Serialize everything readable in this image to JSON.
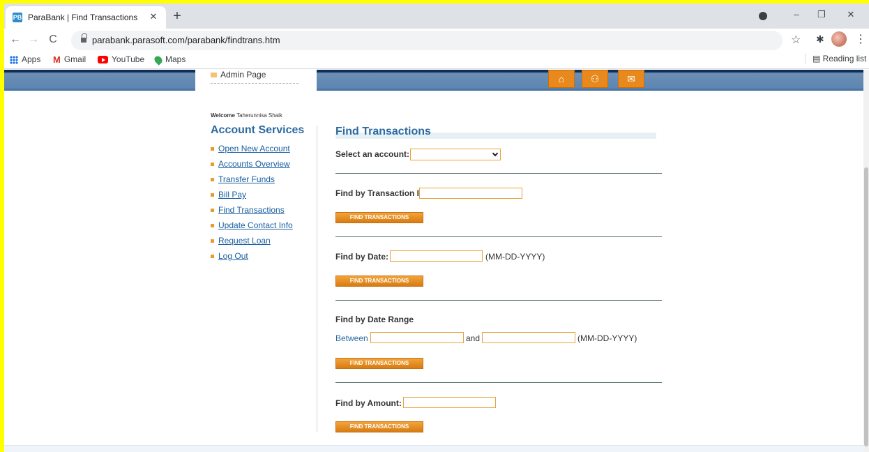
{
  "browser": {
    "tab_title": "ParaBank | Find Transactions",
    "tab_close": "✕",
    "new_tab": "+",
    "url": "parabank.parasoft.com/parabank/findtrans.htm",
    "bookmarks": [
      "Apps",
      "Gmail",
      "YouTube",
      "Maps"
    ],
    "reading_list": "Reading list",
    "window_controls": [
      "–",
      "❐",
      "✕"
    ]
  },
  "header": {
    "admin_link": "Admin Page",
    "icons": [
      "home-icon",
      "about-icon",
      "contact-icon"
    ]
  },
  "sidebar": {
    "welcome_label": "Welcome",
    "user_name": "Taherunnisa Shaik",
    "title": "Account Services",
    "links": [
      "Open New Account",
      "Accounts Overview",
      "Transfer Funds",
      "Bill Pay",
      "Find Transactions",
      "Update Contact Info",
      "Request Loan",
      "Log Out"
    ]
  },
  "main": {
    "title": "Find Transactions",
    "select_account_label": "Select an account:",
    "select_account_value": "",
    "by_id_label": "Find by Transaction ID:",
    "by_date_label": "Find by Date:",
    "date_format": "(MM-DD-YYYY)",
    "by_range_label": "Find by Date Range",
    "between_label": "Between",
    "and_label": "and",
    "by_amount_label": "Find by Amount:",
    "button_label": "FIND TRANSACTIONS"
  },
  "colors": {
    "page_border": "#ffff00",
    "accent_blue": "#2c6aa0",
    "button_orange": "#e8891d"
  }
}
